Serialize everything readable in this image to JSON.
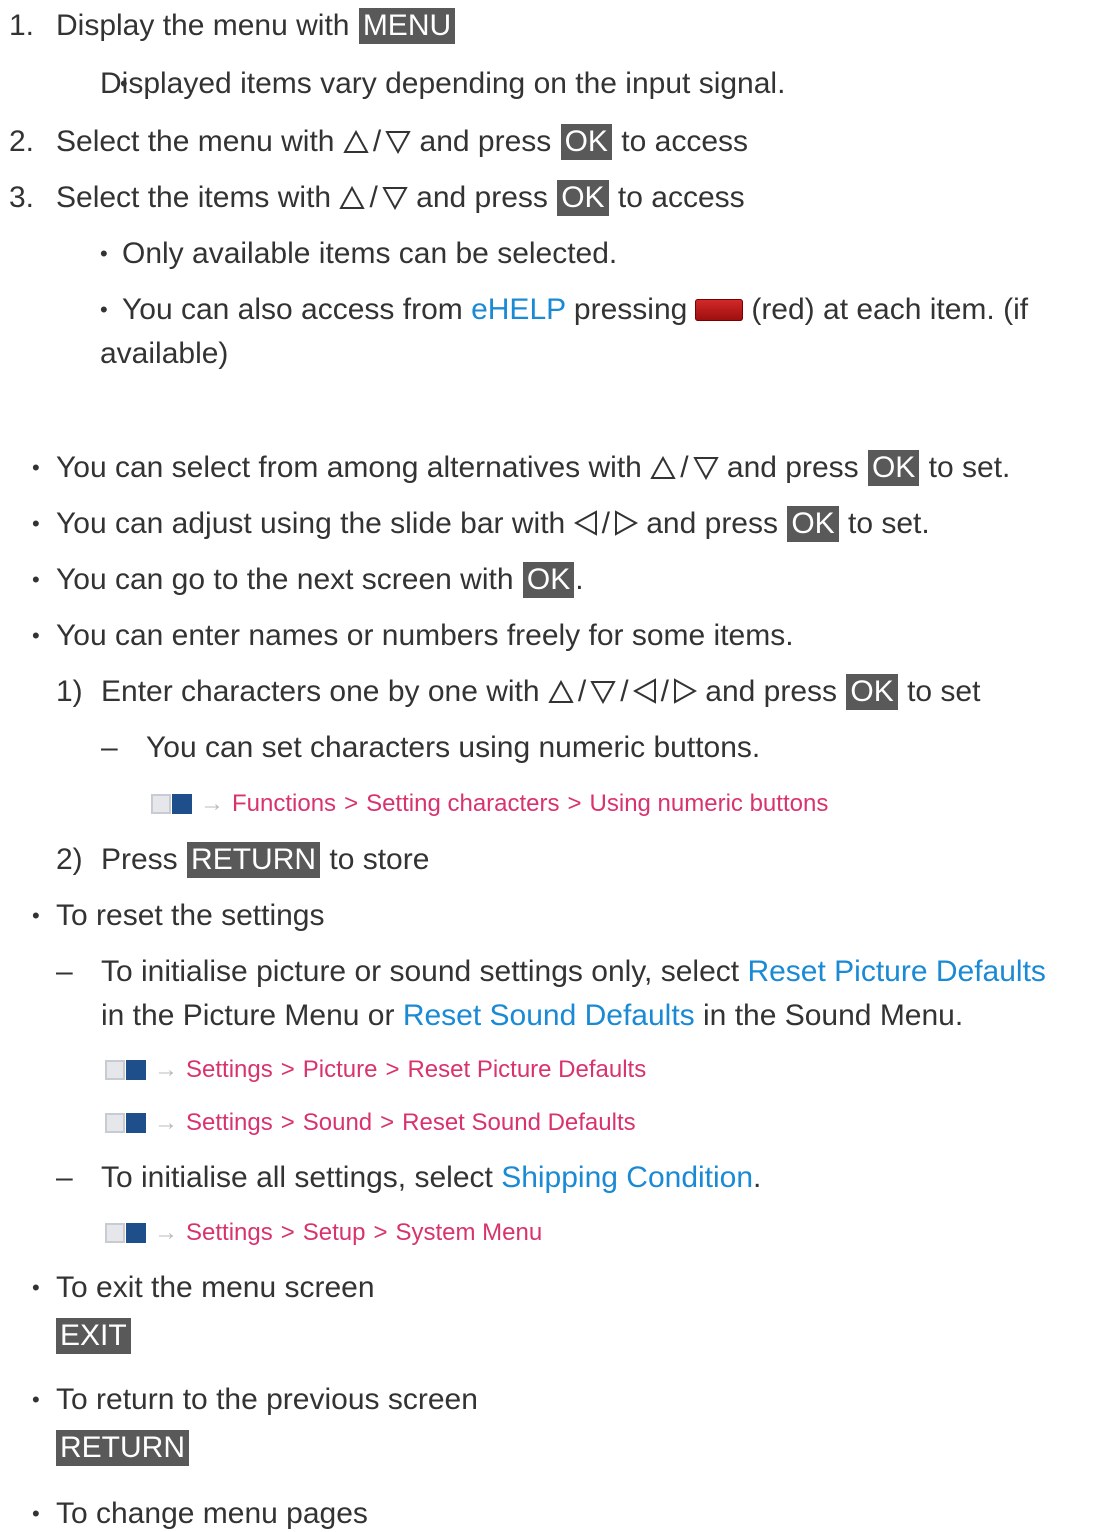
{
  "steps": [
    {
      "num": "1.",
      "prefix": "Display the menu with ",
      "key": "MENU"
    },
    {
      "num": "2.",
      "prefix": "Select the menu with ",
      "mid": " and press ",
      "key": "OK",
      "suffix": " to access"
    },
    {
      "num": "3.",
      "prefix": "Select the items with ",
      "mid": " and press ",
      "key": "OK",
      "suffix": " to access"
    }
  ],
  "step1_note": "Displayed items vary depending on the input signal.",
  "step3_notes": {
    "only_available": "Only available items can be selected.",
    "ehelp_prefix": "You can also access from ",
    "ehelp_link": "eHELP",
    "ehelp_mid": " pressing",
    "ehelp_suffix": "(red) at each item. (if",
    "ehelp_cont": "available)"
  },
  "bullets": {
    "alternatives": {
      "prefix": "You can select from among alternatives with ",
      "mid": " and press ",
      "key": "OK",
      "suffix": " to set."
    },
    "slidebar": {
      "prefix": "You can adjust using the slide bar with ",
      "mid": " and press ",
      "key": "OK",
      "suffix": " to set."
    },
    "next_screen": {
      "prefix": "You can go to the next screen with ",
      "key": "OK",
      "suffix": "."
    },
    "enter_names": "You can enter names or numbers freely for some items.",
    "sub1": {
      "num": "1)",
      "prefix": "Enter characters one by one with ",
      "mid": " and press ",
      "key": "OK",
      "suffix": " to set"
    },
    "sub1_note": "You can set characters using numeric buttons.",
    "sub1_path": [
      "Functions",
      "Setting characters",
      "Using numeric buttons"
    ],
    "sub2": {
      "num": "2)",
      "prefix": "Press ",
      "key": "RETURN",
      "suffix": " to store"
    },
    "reset": "To reset the settings",
    "reset_note": {
      "prefix": "To initialise picture or sound settings only, select ",
      "link1": "Reset Picture Defaults",
      "line2_prefix": "in the Picture Menu or ",
      "link2": "Reset Sound Defaults",
      "line2_suffix": " in the Sound Menu."
    },
    "reset_path1": [
      "Settings",
      "Picture",
      "Reset Picture Defaults"
    ],
    "reset_path2": [
      "Settings",
      "Sound",
      "Reset Sound Defaults"
    ],
    "reset_all": {
      "prefix": "To initialise all settings, select ",
      "link": "Shipping Condition",
      "suffix": "."
    },
    "reset_path3": [
      "Settings",
      "Setup",
      "System Menu"
    ],
    "exit": "To exit the menu screen",
    "exit_key": "EXIT",
    "return": "To return to the previous screen",
    "return_key": "RETURN",
    "change_pages": "To change menu pages"
  },
  "glyphs": {
    "slash": "/",
    "sep": ">",
    "arrow": "→",
    "bullet": "•",
    "dash": "–"
  },
  "colors": {
    "key_bg": "#595959",
    "link": "#1a8ad4",
    "path": "#d9336e",
    "red_button": "#c21a1a"
  }
}
